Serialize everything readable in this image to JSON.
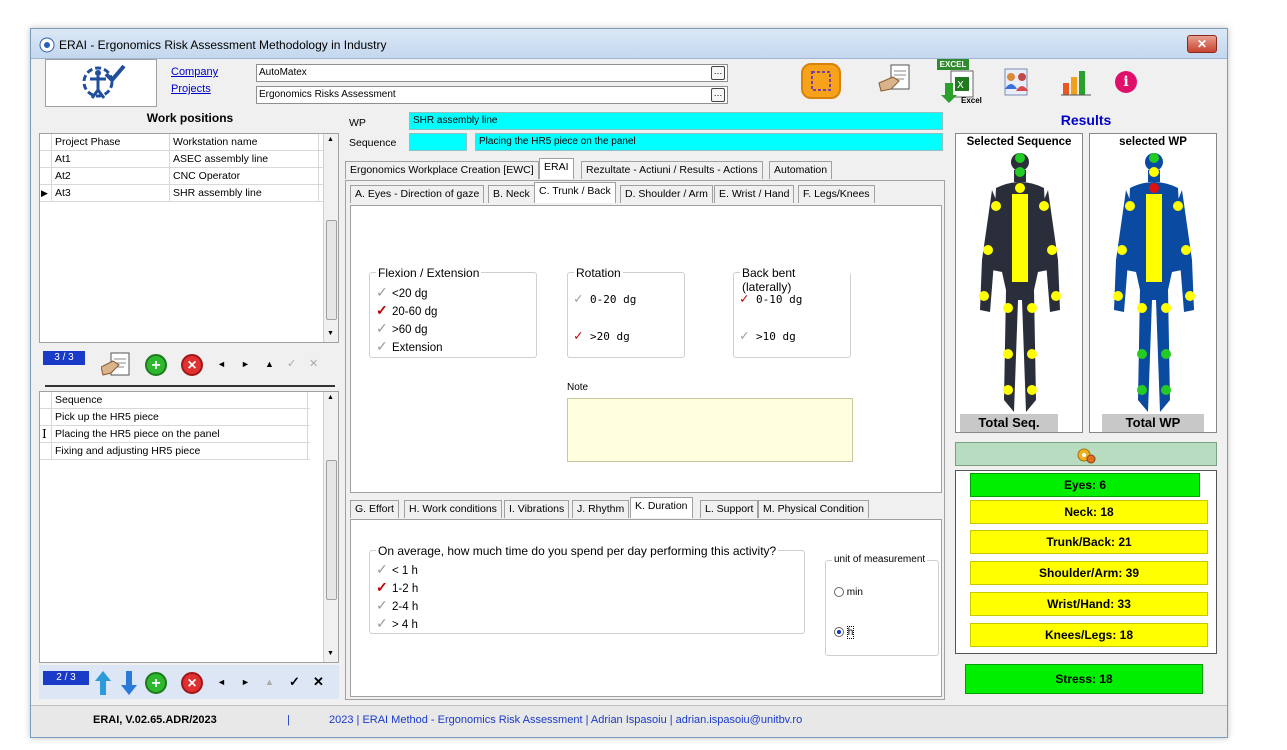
{
  "window": {
    "title": "ERAI - Ergonomics Risk Assessment Methodology in Industry",
    "close": "✕"
  },
  "header": {
    "company_link": "Company",
    "projects_link": "Projects",
    "company_value": "AutoMatex",
    "project_value": "Ergonomics Risks Assessment",
    "combo_button": "…",
    "excel_label": "EXCEL",
    "excel_sub": "Excel",
    "info_glyph": "i"
  },
  "work_positions": {
    "title": "Work positions",
    "columns": [
      "Project Phase",
      "Workstation name"
    ],
    "rows": [
      {
        "phase": "At1",
        "name": "ASEC assembly line"
      },
      {
        "phase": "At2",
        "name": "CNC Operator"
      },
      {
        "phase": "At3",
        "name": "SHR assembly line"
      }
    ],
    "current_marker": "▶",
    "counter": "3 / 3"
  },
  "sequences": {
    "column": "Sequence",
    "rows": [
      "Pick up the HR5 piece",
      "Placing the HR5 piece on the panel",
      "Fixing and adjusting HR5 piece"
    ],
    "cursor_marker": "I",
    "counter": "2 / 3"
  },
  "nav": {
    "first": "◄",
    "next": "►",
    "up": "▲",
    "check": "✓",
    "cancel": "✕",
    "add": "+",
    "remove": "×"
  },
  "wp_info": {
    "wp_label": "WP",
    "wp_value": "SHR assembly line",
    "sequence_label": "Sequence",
    "sequence_value": "Placing the HR5 piece on the panel"
  },
  "main_tabs": [
    "Ergonomics Workplace Creation [EWC]",
    "ERAI",
    "Rezultate - Actiuni / Results - Actions",
    "Automation"
  ],
  "sub_tabs": [
    "A. Eyes - Direction of gaze",
    "B. Neck",
    "C. Trunk / Back",
    "D. Shoulder / Arm",
    "E. Wrist / Hand",
    "F. Legs/Knees"
  ],
  "trunk": {
    "flexion": {
      "title": "Flexion / Extension",
      "options": [
        {
          "label": "<20 dg",
          "checked": false
        },
        {
          "label": "20-60 dg",
          "checked": true
        },
        {
          "label": ">60 dg",
          "checked": false
        },
        {
          "label": "Extension",
          "checked": false
        }
      ]
    },
    "rotation": {
      "title": "Rotation",
      "options": [
        {
          "label": "0-20 dg",
          "checked": false
        },
        {
          "label": ">20 dg",
          "checked": true
        }
      ]
    },
    "bent": {
      "title": "Back bent (laterally)",
      "options": [
        {
          "label": "0-10 dg",
          "checked": true
        },
        {
          "label": ">10 dg",
          "checked": false
        }
      ]
    },
    "note_label": "Note"
  },
  "lower_tabs": [
    "G. Effort",
    "H. Work conditions",
    "I. Vibrations",
    "J. Rhythm",
    "K. Duration",
    "L. Support",
    "M. Physical Condition"
  ],
  "duration": {
    "question": "On average, how much time do you spend per day performing this activity?",
    "options": [
      {
        "label": "< 1 h",
        "checked": false
      },
      {
        "label": "1-2 h",
        "checked": true
      },
      {
        "label": "2-4 h",
        "checked": false
      },
      {
        "label": "> 4 h",
        "checked": false
      }
    ],
    "unit_title": "unit of measurement",
    "unit_min": "min",
    "unit_h": "h",
    "selected_unit": "h"
  },
  "results": {
    "title": "Results",
    "selected_sequence": "Selected Sequence",
    "selected_wp": "selected WP",
    "total_seq": "Total Seq.",
    "total_wp": "Total WP",
    "scores": [
      {
        "label": "Eyes: 6",
        "color": "green"
      },
      {
        "label": "Neck: 18",
        "color": "yellow"
      },
      {
        "label": "Trunk/Back: 21",
        "color": "yellow"
      },
      {
        "label": "Shoulder/Arm: 39",
        "color": "yellow"
      },
      {
        "label": "Wrist/Hand: 33",
        "color": "yellow"
      },
      {
        "label": "Knees/Legs: 18",
        "color": "yellow"
      }
    ],
    "stress": "Stress: 18"
  },
  "status": {
    "version": "ERAI, V.02.65.ADR/2023",
    "separator": "|",
    "credits": "2023 | ERAI Method - Ergonomics Risk Assessment | Adrian Ispasoiu | adrian.ispasoiu@unitbv.ro"
  },
  "colors": {
    "cyan_field": "#00ffff",
    "note_bg": "#ffffe0",
    "results_title": "#0000cc",
    "accent_blue": "#1a3ac8"
  }
}
